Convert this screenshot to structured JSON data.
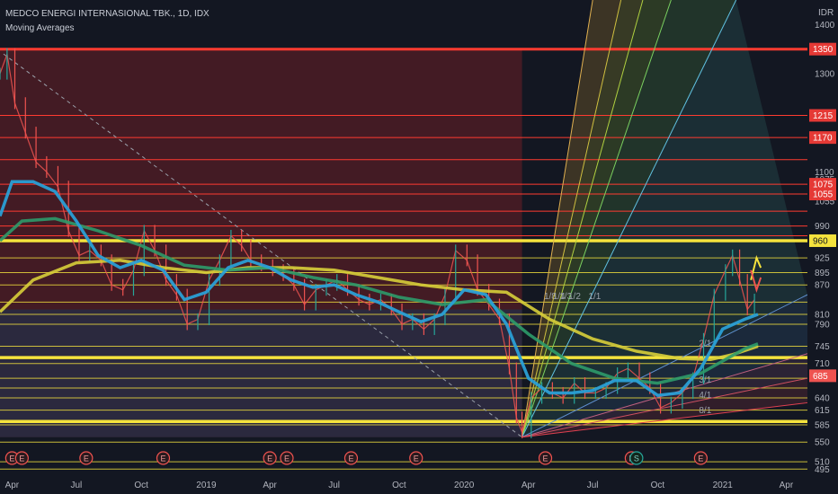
{
  "header": {
    "symbol_line": "MEDCO ENERGI INTERNASIONAL TBK., 1D, IDX",
    "indicator": "Moving Averages"
  },
  "currency": "IDR",
  "colors": {
    "background": "#131722",
    "red_zone": "#6b1f27",
    "blue_zone": "#1c3350",
    "red_line": "#ff3b30",
    "yellow_line": "#f5e33d",
    "ma_fast": "#2a9fd6",
    "ma_mid": "#2e9b6a",
    "ma_slow": "#d8cf3a",
    "candle_up": "#26a69a",
    "candle_down": "#ef5350",
    "axis_text": "#b2b5be"
  },
  "chart_data": {
    "type": "line",
    "title": "MEDCO ENERGI INTERNASIONAL TBK., 1D, IDX",
    "ylim": [
      490,
      1450
    ],
    "x_range": [
      "2018-03-15",
      "2021-05-01"
    ],
    "x_ticks": [
      {
        "label": "Apr",
        "date": "2018-04-01"
      },
      {
        "label": "Jul",
        "date": "2018-07-01"
      },
      {
        "label": "Oct",
        "date": "2018-10-01"
      },
      {
        "label": "2019",
        "date": "2019-01-01"
      },
      {
        "label": "Apr",
        "date": "2019-04-01"
      },
      {
        "label": "Jul",
        "date": "2019-07-01"
      },
      {
        "label": "Oct",
        "date": "2019-10-01"
      },
      {
        "label": "2020",
        "date": "2020-01-01"
      },
      {
        "label": "Apr",
        "date": "2020-04-01"
      },
      {
        "label": "Jul",
        "date": "2020-07-01"
      },
      {
        "label": "Oct",
        "date": "2020-10-01"
      },
      {
        "label": "2021",
        "date": "2021-01-01"
      },
      {
        "label": "Apr",
        "date": "2021-04-01"
      }
    ],
    "y_ticks": [
      "1400",
      "1300",
      "1100",
      "1075",
      "1055",
      "990",
      "960",
      "925",
      "895",
      "870",
      "810",
      "790",
      "745",
      "710",
      "680",
      "640",
      "615",
      "585",
      "550",
      "510",
      "495"
    ],
    "level_tags": [
      {
        "value": 1350,
        "label": "1350",
        "kind": "red"
      },
      {
        "value": 1215,
        "label": "1215",
        "kind": "red"
      },
      {
        "value": 1170,
        "label": "1170",
        "kind": "red"
      },
      {
        "value": 1075,
        "label": "1075",
        "kind": "red"
      },
      {
        "value": 1055,
        "label": "1055",
        "kind": "red"
      },
      {
        "value": 960,
        "label": "960",
        "kind": "yellow"
      },
      {
        "value": 685,
        "label": "685",
        "kind": "current"
      }
    ],
    "red_levels": [
      1350,
      1215,
      1170,
      1125,
      1075,
      1055,
      1020,
      990,
      970
    ],
    "yellow_levels": [
      960,
      925,
      895,
      870,
      835,
      810,
      790,
      745,
      722,
      710,
      680,
      660,
      640,
      615,
      585,
      550,
      510,
      495
    ],
    "thick_yellow_levels": [
      960,
      722,
      592
    ],
    "price_series": [
      {
        "date": "2018-03-15",
        "value": 1300
      },
      {
        "date": "2018-03-25",
        "value": 1340
      },
      {
        "date": "2018-04-05",
        "value": 1240
      },
      {
        "date": "2018-04-20",
        "value": 1180
      },
      {
        "date": "2018-05-05",
        "value": 1120
      },
      {
        "date": "2018-05-20",
        "value": 1100
      },
      {
        "date": "2018-06-05",
        "value": 1070
      },
      {
        "date": "2018-06-20",
        "value": 980
      },
      {
        "date": "2018-07-05",
        "value": 930
      },
      {
        "date": "2018-07-20",
        "value": 940
      },
      {
        "date": "2018-08-05",
        "value": 920
      },
      {
        "date": "2018-08-20",
        "value": 870
      },
      {
        "date": "2018-09-05",
        "value": 860
      },
      {
        "date": "2018-09-20",
        "value": 900
      },
      {
        "date": "2018-10-05",
        "value": 980
      },
      {
        "date": "2018-10-20",
        "value": 940
      },
      {
        "date": "2018-11-05",
        "value": 880
      },
      {
        "date": "2018-11-20",
        "value": 850
      },
      {
        "date": "2018-12-05",
        "value": 790
      },
      {
        "date": "2018-12-20",
        "value": 800
      },
      {
        "date": "2019-01-05",
        "value": 880
      },
      {
        "date": "2019-01-20",
        "value": 920
      },
      {
        "date": "2019-02-05",
        "value": 970
      },
      {
        "date": "2019-02-20",
        "value": 950
      },
      {
        "date": "2019-03-05",
        "value": 920
      },
      {
        "date": "2019-03-20",
        "value": 910
      },
      {
        "date": "2019-04-05",
        "value": 900
      },
      {
        "date": "2019-04-20",
        "value": 890
      },
      {
        "date": "2019-05-05",
        "value": 870
      },
      {
        "date": "2019-05-20",
        "value": 830
      },
      {
        "date": "2019-06-05",
        "value": 860
      },
      {
        "date": "2019-06-20",
        "value": 870
      },
      {
        "date": "2019-07-05",
        "value": 880
      },
      {
        "date": "2019-07-20",
        "value": 860
      },
      {
        "date": "2019-08-05",
        "value": 840
      },
      {
        "date": "2019-08-20",
        "value": 830
      },
      {
        "date": "2019-09-05",
        "value": 840
      },
      {
        "date": "2019-09-20",
        "value": 820
      },
      {
        "date": "2019-10-05",
        "value": 790
      },
      {
        "date": "2019-10-20",
        "value": 800
      },
      {
        "date": "2019-11-05",
        "value": 780
      },
      {
        "date": "2019-11-20",
        "value": 800
      },
      {
        "date": "2019-12-05",
        "value": 850
      },
      {
        "date": "2019-12-20",
        "value": 940
      },
      {
        "date": "2020-01-05",
        "value": 920
      },
      {
        "date": "2020-01-20",
        "value": 860
      },
      {
        "date": "2020-02-05",
        "value": 830
      },
      {
        "date": "2020-02-20",
        "value": 800
      },
      {
        "date": "2020-03-05",
        "value": 700
      },
      {
        "date": "2020-03-15",
        "value": 600
      },
      {
        "date": "2020-03-23",
        "value": 570
      },
      {
        "date": "2020-04-05",
        "value": 640
      },
      {
        "date": "2020-04-20",
        "value": 660
      },
      {
        "date": "2020-05-05",
        "value": 650
      },
      {
        "date": "2020-05-20",
        "value": 640
      },
      {
        "date": "2020-06-05",
        "value": 670
      },
      {
        "date": "2020-06-20",
        "value": 650
      },
      {
        "date": "2020-07-05",
        "value": 650
      },
      {
        "date": "2020-07-20",
        "value": 660
      },
      {
        "date": "2020-08-05",
        "value": 690
      },
      {
        "date": "2020-08-20",
        "value": 700
      },
      {
        "date": "2020-09-05",
        "value": 680
      },
      {
        "date": "2020-09-20",
        "value": 660
      },
      {
        "date": "2020-10-05",
        "value": 620
      },
      {
        "date": "2020-10-20",
        "value": 630
      },
      {
        "date": "2020-11-05",
        "value": 650
      },
      {
        "date": "2020-11-20",
        "value": 680
      },
      {
        "date": "2020-12-05",
        "value": 760
      },
      {
        "date": "2020-12-20",
        "value": 850
      },
      {
        "date": "2021-01-05",
        "value": 900
      },
      {
        "date": "2021-01-15",
        "value": 930
      },
      {
        "date": "2021-01-25",
        "value": 880
      },
      {
        "date": "2021-02-05",
        "value": 820
      },
      {
        "date": "2021-02-15",
        "value": 840
      }
    ],
    "ma_fast": [
      {
        "date": "2018-03-15",
        "value": 1010
      },
      {
        "date": "2018-04-01",
        "value": 1080
      },
      {
        "date": "2018-05-01",
        "value": 1080
      },
      {
        "date": "2018-06-01",
        "value": 1060
      },
      {
        "date": "2018-07-01",
        "value": 1000
      },
      {
        "date": "2018-08-01",
        "value": 930
      },
      {
        "date": "2018-09-01",
        "value": 905
      },
      {
        "date": "2018-10-01",
        "value": 920
      },
      {
        "date": "2018-11-01",
        "value": 900
      },
      {
        "date": "2018-12-01",
        "value": 840
      },
      {
        "date": "2019-01-01",
        "value": 855
      },
      {
        "date": "2019-02-01",
        "value": 905
      },
      {
        "date": "2019-03-01",
        "value": 920
      },
      {
        "date": "2019-04-01",
        "value": 905
      },
      {
        "date": "2019-05-01",
        "value": 880
      },
      {
        "date": "2019-06-01",
        "value": 865
      },
      {
        "date": "2019-07-01",
        "value": 870
      },
      {
        "date": "2019-08-01",
        "value": 850
      },
      {
        "date": "2019-09-01",
        "value": 835
      },
      {
        "date": "2019-10-01",
        "value": 815
      },
      {
        "date": "2019-11-01",
        "value": 795
      },
      {
        "date": "2019-12-01",
        "value": 810
      },
      {
        "date": "2020-01-01",
        "value": 860
      },
      {
        "date": "2020-02-01",
        "value": 850
      },
      {
        "date": "2020-03-01",
        "value": 790
      },
      {
        "date": "2020-04-01",
        "value": 680
      },
      {
        "date": "2020-05-01",
        "value": 650
      },
      {
        "date": "2020-06-01",
        "value": 650
      },
      {
        "date": "2020-07-01",
        "value": 655
      },
      {
        "date": "2020-08-01",
        "value": 675
      },
      {
        "date": "2020-09-01",
        "value": 675
      },
      {
        "date": "2020-10-01",
        "value": 645
      },
      {
        "date": "2020-11-01",
        "value": 650
      },
      {
        "date": "2020-12-01",
        "value": 700
      },
      {
        "date": "2021-01-01",
        "value": 780
      },
      {
        "date": "2021-02-01",
        "value": 800
      },
      {
        "date": "2021-02-20",
        "value": 810
      }
    ],
    "ma_mid": [
      {
        "date": "2018-03-15",
        "value": 960
      },
      {
        "date": "2018-04-15",
        "value": 1000
      },
      {
        "date": "2018-06-01",
        "value": 1005
      },
      {
        "date": "2018-08-01",
        "value": 980
      },
      {
        "date": "2018-10-01",
        "value": 950
      },
      {
        "date": "2018-12-01",
        "value": 910
      },
      {
        "date": "2019-02-01",
        "value": 900
      },
      {
        "date": "2019-04-01",
        "value": 905
      },
      {
        "date": "2019-06-01",
        "value": 885
      },
      {
        "date": "2019-08-01",
        "value": 870
      },
      {
        "date": "2019-10-01",
        "value": 845
      },
      {
        "date": "2019-12-01",
        "value": 830
      },
      {
        "date": "2020-02-01",
        "value": 840
      },
      {
        "date": "2020-04-01",
        "value": 770
      },
      {
        "date": "2020-06-01",
        "value": 710
      },
      {
        "date": "2020-08-01",
        "value": 680
      },
      {
        "date": "2020-10-01",
        "value": 670
      },
      {
        "date": "2020-12-01",
        "value": 690
      },
      {
        "date": "2021-02-01",
        "value": 740
      },
      {
        "date": "2021-02-20",
        "value": 750
      }
    ],
    "ma_slow": [
      {
        "date": "2018-03-15",
        "value": 815
      },
      {
        "date": "2018-05-01",
        "value": 880
      },
      {
        "date": "2018-07-01",
        "value": 915
      },
      {
        "date": "2018-09-01",
        "value": 920
      },
      {
        "date": "2018-11-01",
        "value": 905
      },
      {
        "date": "2019-01-01",
        "value": 895
      },
      {
        "date": "2019-03-01",
        "value": 905
      },
      {
        "date": "2019-05-01",
        "value": 905
      },
      {
        "date": "2019-07-01",
        "value": 900
      },
      {
        "date": "2019-09-01",
        "value": 885
      },
      {
        "date": "2019-11-01",
        "value": 870
      },
      {
        "date": "2020-01-01",
        "value": 860
      },
      {
        "date": "2020-03-01",
        "value": 855
      },
      {
        "date": "2020-05-01",
        "value": 800
      },
      {
        "date": "2020-07-01",
        "value": 760
      },
      {
        "date": "2020-09-01",
        "value": 735
      },
      {
        "date": "2020-11-01",
        "value": 720
      },
      {
        "date": "2020-12-15",
        "value": 718
      },
      {
        "date": "2021-01-15",
        "value": 728
      },
      {
        "date": "2021-02-20",
        "value": 745
      }
    ],
    "red_zone": {
      "from": "2018-03-15",
      "to": "2020-03-23",
      "top": 1350,
      "bottom": 560
    },
    "diagonal": {
      "from": {
        "date": "2018-03-20",
        "value": 1340
      },
      "to": {
        "date": "2020-03-23",
        "value": 560
      }
    },
    "fan_origin": {
      "date": "2020-03-23",
      "value": 560
    },
    "fan_lines": [
      {
        "to": {
          "date": "2020-07-01",
          "value": 1450
        },
        "label": "1/8"
      },
      {
        "to": {
          "date": "2020-08-10",
          "value": 1450
        },
        "label": "1/4"
      },
      {
        "to": {
          "date": "2020-09-10",
          "value": 1450
        },
        "label": "1/3"
      },
      {
        "to": {
          "date": "2020-10-20",
          "value": 1450
        },
        "label": "1/2"
      },
      {
        "to": {
          "date": "2021-01-20",
          "value": 1450
        },
        "label": "1/1"
      },
      {
        "to": {
          "date": "2021-05-01",
          "value": 850
        },
        "label": "2/1"
      },
      {
        "to": {
          "date": "2021-05-01",
          "value": 730
        },
        "label": "3/1"
      },
      {
        "to": {
          "date": "2021-05-01",
          "value": 680
        },
        "label": "4/1"
      },
      {
        "to": {
          "date": "2021-05-01",
          "value": 630
        },
        "label": "8/1"
      }
    ],
    "earnings_markers": [
      "2018-04-01",
      "2018-04-15",
      "2018-07-15",
      "2018-11-01",
      "2019-04-01",
      "2019-04-25",
      "2019-07-25",
      "2019-10-25",
      "2020-04-25",
      "2020-08-25",
      "2020-12-01"
    ],
    "dividend_marker": {
      "date": "2020-09-01",
      "label": "S"
    },
    "earnings_label": "E"
  }
}
